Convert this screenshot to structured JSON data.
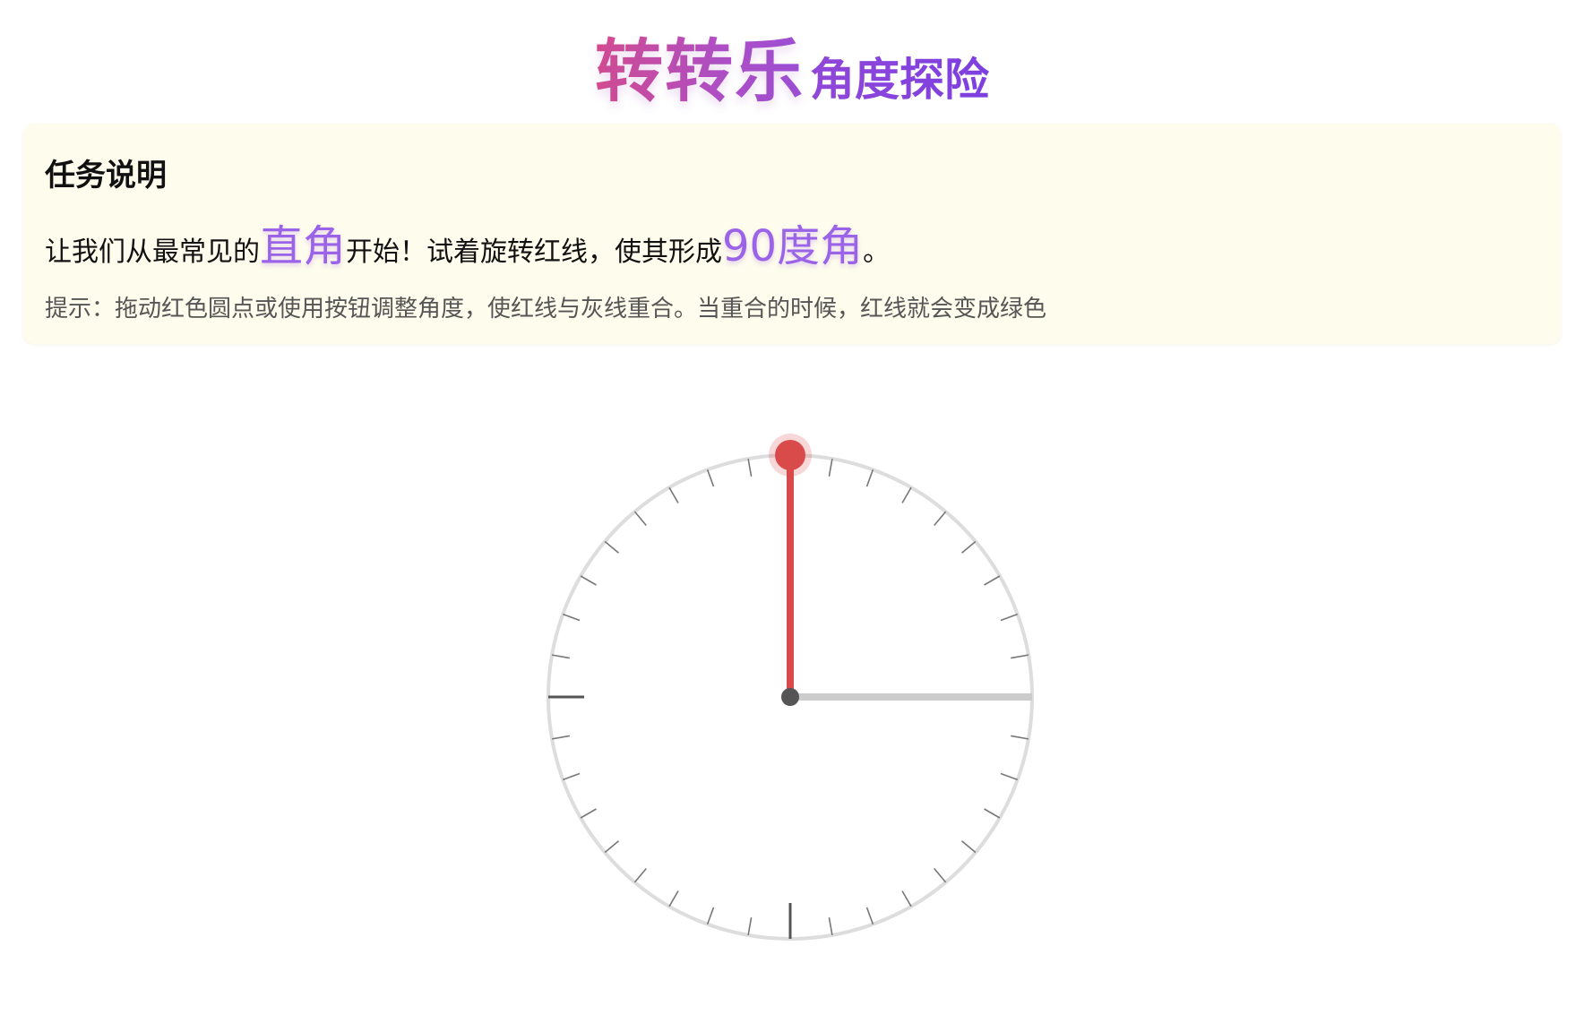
{
  "header": {
    "title_main": "转转乐",
    "title_sub": "角度探险"
  },
  "task": {
    "heading": "任务说明",
    "text_before": "让我们从最常见的",
    "highlight_1": "直角",
    "text_middle": "开始！试着旋转红线，使其形成",
    "highlight_2": "90度角",
    "text_after": "。",
    "hint": "提示：拖动红色圆点或使用按钮调整角度，使红线与灰线重合。当重合的时候，红线就会变成绿色"
  },
  "dial": {
    "current_angle_deg": 90,
    "target_angle_deg": 0,
    "tick_count": 36,
    "colors": {
      "active_line": "#d94b4b",
      "target_line": "#cccccc",
      "success_line": "#3cb371",
      "circle": "#dddddd",
      "tick": "#777777",
      "major_tick": "#555555",
      "center": "#555555"
    },
    "icons": {
      "handle": "drag-handle-dot",
      "center": "center-pivot-dot"
    }
  }
}
